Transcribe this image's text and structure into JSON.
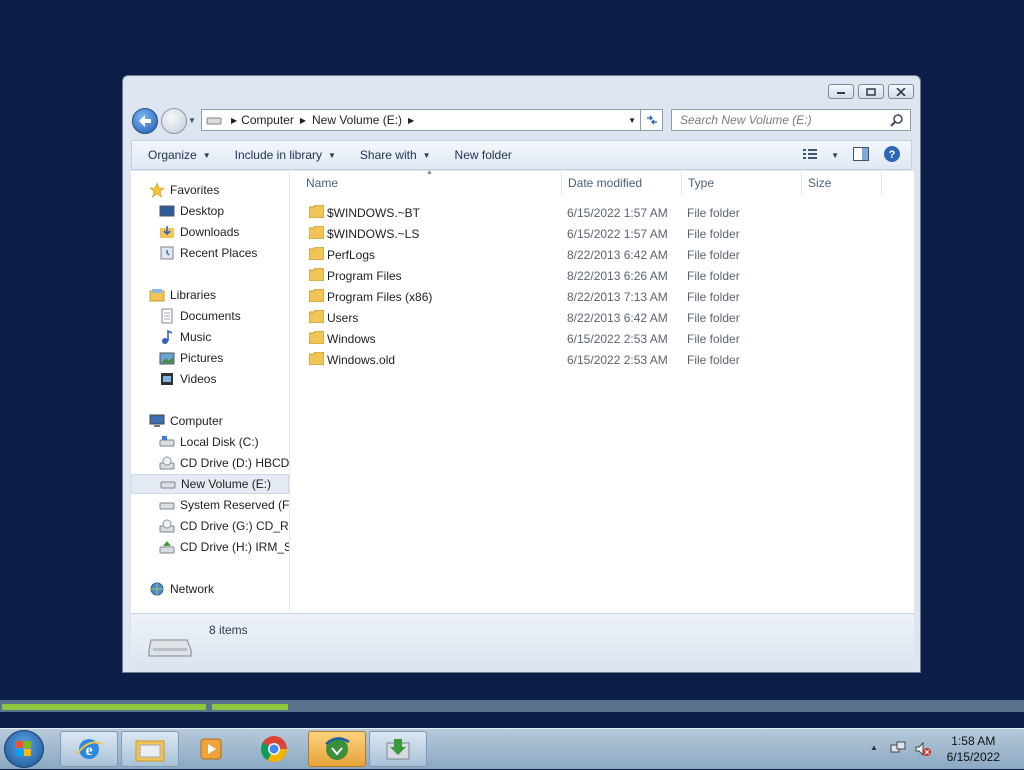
{
  "window": {
    "address": {
      "crumbs": [
        "Computer",
        "New Volume (E:)"
      ]
    },
    "search_placeholder": "Search New Volume (E:)",
    "toolbar": {
      "organize": "Organize",
      "include_in_library": "Include in library",
      "share_with": "Share with",
      "new_folder": "New folder"
    },
    "nav": {
      "favorites": "Favorites",
      "favorites_items": [
        "Desktop",
        "Downloads",
        "Recent Places"
      ],
      "libraries": "Libraries",
      "libraries_items": [
        "Documents",
        "Music",
        "Pictures",
        "Videos"
      ],
      "computer": "Computer",
      "computer_items": [
        "Local Disk (C:)",
        "CD Drive (D:) HBCD_",
        "New Volume (E:)",
        "System Reserved (F:)",
        "CD Drive (G:) CD_RC",
        "CD Drive (H:) IRM_SI"
      ],
      "network": "Network"
    },
    "columns": [
      "Name",
      "Date modified",
      "Type",
      "Size"
    ],
    "files": [
      {
        "name": "$WINDOWS.~BT",
        "date": "6/15/2022 1:57 AM",
        "type": "File folder"
      },
      {
        "name": "$WINDOWS.~LS",
        "date": "6/15/2022 1:57 AM",
        "type": "File folder"
      },
      {
        "name": "PerfLogs",
        "date": "8/22/2013 6:42 AM",
        "type": "File folder"
      },
      {
        "name": "Program Files",
        "date": "8/22/2013 6:26 AM",
        "type": "File folder"
      },
      {
        "name": "Program Files (x86)",
        "date": "8/22/2013 7:13 AM",
        "type": "File folder"
      },
      {
        "name": "Users",
        "date": "8/22/2013 6:42 AM",
        "type": "File folder"
      },
      {
        "name": "Windows",
        "date": "6/15/2022 2:53 AM",
        "type": "File folder"
      },
      {
        "name": "Windows.old",
        "date": "6/15/2022 2:53 AM",
        "type": "File folder"
      }
    ],
    "status": "8 items"
  },
  "taskbar": {
    "time": "1:58 AM",
    "date": "6/15/2022"
  },
  "colors": {
    "desktop": "#0c1e48",
    "progress": "#8dc63f",
    "folder": "#f1c45a"
  }
}
